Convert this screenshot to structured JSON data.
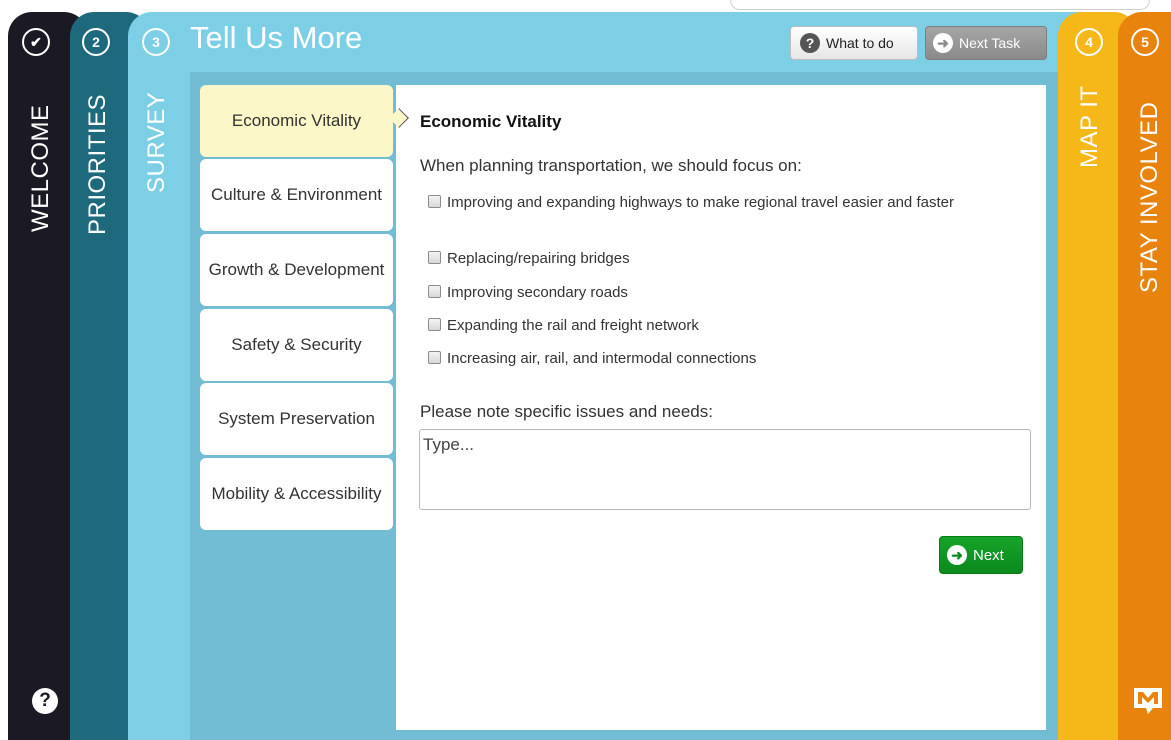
{
  "tabs": {
    "welcome": {
      "label": "WELCOME",
      "badge": "✔"
    },
    "priorities": {
      "label": "PRIORITIES",
      "badge": "2"
    },
    "survey": {
      "label": "SURVEY",
      "badge": "3",
      "title": "Tell Us More"
    },
    "map_it": {
      "label": "MAP IT",
      "badge": "4"
    },
    "stay_involved": {
      "label": "STAY INVOLVED",
      "badge": "5"
    }
  },
  "header_buttons": {
    "what_to_do": {
      "icon": "question-icon",
      "label": "What to do"
    },
    "next_task": {
      "icon": "arrow-right-icon",
      "label": "Next Task"
    }
  },
  "survey_nav": [
    {
      "label": "Economic Vitality",
      "active": true
    },
    {
      "label": "Culture & Environment",
      "active": false
    },
    {
      "label": "Growth & Development",
      "active": false
    },
    {
      "label": "Safety & Security",
      "active": false
    },
    {
      "label": "System Preservation",
      "active": false
    },
    {
      "label": "Mobility & Accessibility",
      "active": false
    }
  ],
  "content": {
    "title": "Economic Vitality",
    "question": "When planning transportation, we should focus on:",
    "options": [
      "Improving and expanding highways to make regional travel easier and faster",
      "Replacing/repairing bridges",
      "Improving secondary roads",
      "Expanding the rail and freight network",
      "Increasing air, rail, and intermodal connections"
    ],
    "notes_label": "Please note specific issues and needs:",
    "notes_placeholder": "Type...",
    "next_button": "Next"
  },
  "colors": {
    "welcome": "#1b1923",
    "priorities": "#1e6a7c",
    "survey": "#7dcfe6",
    "map_it": "#f6b719",
    "stay_involved": "#e8830d",
    "next_green": "#0f9a22"
  },
  "icons": {
    "help": "question-icon",
    "logo": "logo-icon"
  }
}
